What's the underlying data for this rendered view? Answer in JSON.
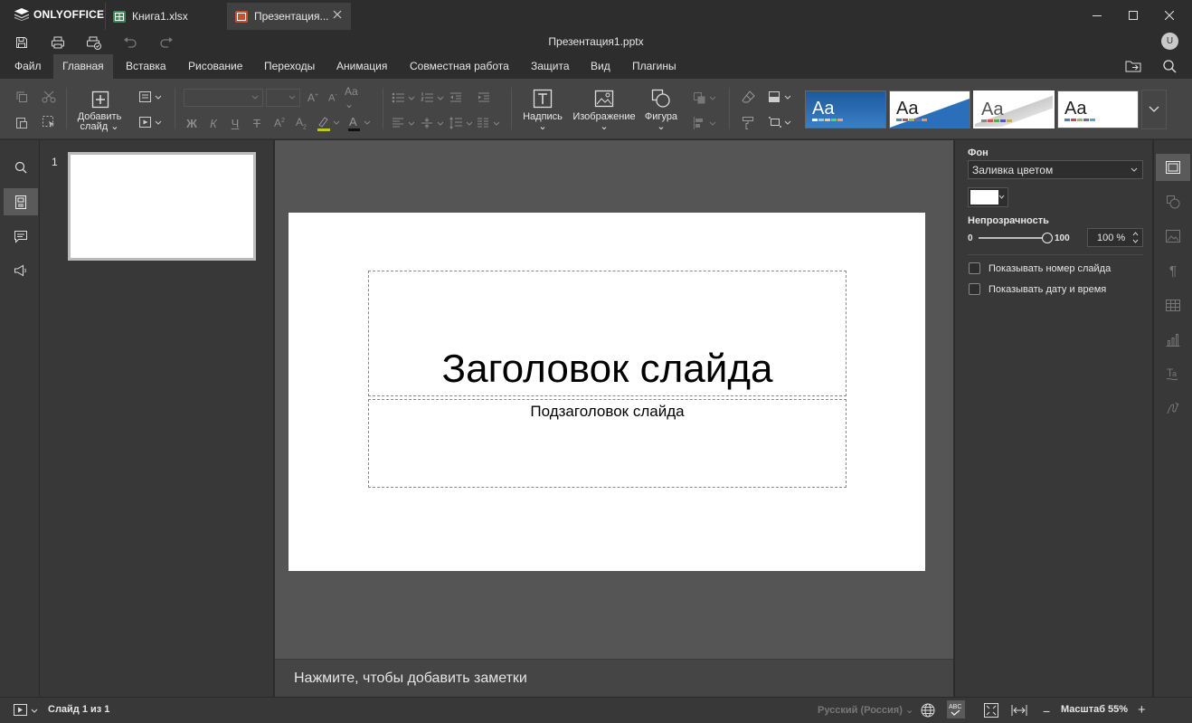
{
  "app": {
    "brand": "ONLYOFFICE"
  },
  "tabs": [
    {
      "label": "Книга1.xlsx",
      "color": "#3d8a56",
      "active": false
    },
    {
      "label": "Презентация...",
      "color": "#c6512f",
      "active": true
    }
  ],
  "document": {
    "title": "Презентация1.pptx",
    "user_initial": "U"
  },
  "menu": [
    "Файл",
    "Главная",
    "Вставка",
    "Рисование",
    "Переходы",
    "Анимация",
    "Совместная работа",
    "Защита",
    "Вид",
    "Плагины"
  ],
  "toolbar": {
    "add_slide_line1": "Добавить",
    "add_slide_line2": "слайд",
    "textbox": "Надпись",
    "image": "Изображение",
    "shape": "Фигура",
    "theme_sample": "Aa",
    "bold": "Ж",
    "italic": "К",
    "underline": "Ч",
    "strike": "Т"
  },
  "thumbnails": {
    "number": "1"
  },
  "slide": {
    "title": "Заголовок слайда",
    "subtitle": "Подзаголовок слайда"
  },
  "notes": {
    "placeholder": "Нажмите, чтобы добавить заметки"
  },
  "panel": {
    "background_label": "Фон",
    "fill_option": "Заливка цветом",
    "fill_color": "#ffffff",
    "opacity_label": "Непрозрачность",
    "opacity_min": "0",
    "opacity_max": "100",
    "opacity_value": "100 %",
    "opacity_fraction": 1.0,
    "show_slide_number": "Показывать номер слайда",
    "show_date_time": "Показывать дату и время"
  },
  "status": {
    "slide_info": "Слайд 1 из 1",
    "language": "Русский (Россия)",
    "zoom": "Масштаб 55%"
  },
  "colors": {
    "accent_active_tab": "#404040",
    "toolbar_bg": "#454545"
  }
}
